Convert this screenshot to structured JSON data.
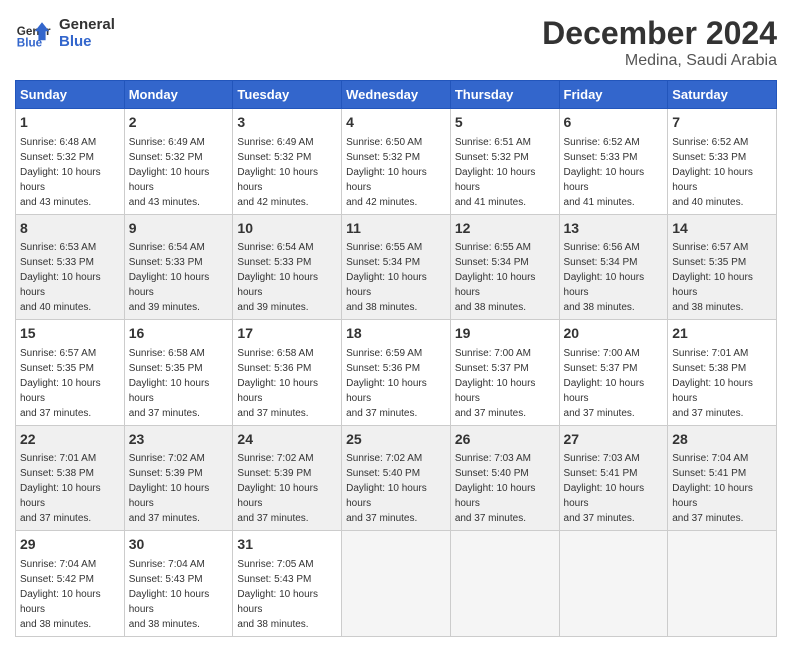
{
  "header": {
    "logo_text_line1": "General",
    "logo_text_line2": "Blue",
    "month_title": "December 2024",
    "location": "Medina, Saudi Arabia"
  },
  "weekdays": [
    "Sunday",
    "Monday",
    "Tuesday",
    "Wednesday",
    "Thursday",
    "Friday",
    "Saturday"
  ],
  "rows": [
    [
      {
        "day": "1",
        "sunrise": "6:48 AM",
        "sunset": "5:32 PM",
        "daylight": "10 hours and 43 minutes."
      },
      {
        "day": "2",
        "sunrise": "6:49 AM",
        "sunset": "5:32 PM",
        "daylight": "10 hours and 43 minutes."
      },
      {
        "day": "3",
        "sunrise": "6:49 AM",
        "sunset": "5:32 PM",
        "daylight": "10 hours and 42 minutes."
      },
      {
        "day": "4",
        "sunrise": "6:50 AM",
        "sunset": "5:32 PM",
        "daylight": "10 hours and 42 minutes."
      },
      {
        "day": "5",
        "sunrise": "6:51 AM",
        "sunset": "5:32 PM",
        "daylight": "10 hours and 41 minutes."
      },
      {
        "day": "6",
        "sunrise": "6:52 AM",
        "sunset": "5:33 PM",
        "daylight": "10 hours and 41 minutes."
      },
      {
        "day": "7",
        "sunrise": "6:52 AM",
        "sunset": "5:33 PM",
        "daylight": "10 hours and 40 minutes."
      }
    ],
    [
      {
        "day": "8",
        "sunrise": "6:53 AM",
        "sunset": "5:33 PM",
        "daylight": "10 hours and 40 minutes."
      },
      {
        "day": "9",
        "sunrise": "6:54 AM",
        "sunset": "5:33 PM",
        "daylight": "10 hours and 39 minutes."
      },
      {
        "day": "10",
        "sunrise": "6:54 AM",
        "sunset": "5:33 PM",
        "daylight": "10 hours and 39 minutes."
      },
      {
        "day": "11",
        "sunrise": "6:55 AM",
        "sunset": "5:34 PM",
        "daylight": "10 hours and 38 minutes."
      },
      {
        "day": "12",
        "sunrise": "6:55 AM",
        "sunset": "5:34 PM",
        "daylight": "10 hours and 38 minutes."
      },
      {
        "day": "13",
        "sunrise": "6:56 AM",
        "sunset": "5:34 PM",
        "daylight": "10 hours and 38 minutes."
      },
      {
        "day": "14",
        "sunrise": "6:57 AM",
        "sunset": "5:35 PM",
        "daylight": "10 hours and 38 minutes."
      }
    ],
    [
      {
        "day": "15",
        "sunrise": "6:57 AM",
        "sunset": "5:35 PM",
        "daylight": "10 hours and 37 minutes."
      },
      {
        "day": "16",
        "sunrise": "6:58 AM",
        "sunset": "5:35 PM",
        "daylight": "10 hours and 37 minutes."
      },
      {
        "day": "17",
        "sunrise": "6:58 AM",
        "sunset": "5:36 PM",
        "daylight": "10 hours and 37 minutes."
      },
      {
        "day": "18",
        "sunrise": "6:59 AM",
        "sunset": "5:36 PM",
        "daylight": "10 hours and 37 minutes."
      },
      {
        "day": "19",
        "sunrise": "7:00 AM",
        "sunset": "5:37 PM",
        "daylight": "10 hours and 37 minutes."
      },
      {
        "day": "20",
        "sunrise": "7:00 AM",
        "sunset": "5:37 PM",
        "daylight": "10 hours and 37 minutes."
      },
      {
        "day": "21",
        "sunrise": "7:01 AM",
        "sunset": "5:38 PM",
        "daylight": "10 hours and 37 minutes."
      }
    ],
    [
      {
        "day": "22",
        "sunrise": "7:01 AM",
        "sunset": "5:38 PM",
        "daylight": "10 hours and 37 minutes."
      },
      {
        "day": "23",
        "sunrise": "7:02 AM",
        "sunset": "5:39 PM",
        "daylight": "10 hours and 37 minutes."
      },
      {
        "day": "24",
        "sunrise": "7:02 AM",
        "sunset": "5:39 PM",
        "daylight": "10 hours and 37 minutes."
      },
      {
        "day": "25",
        "sunrise": "7:02 AM",
        "sunset": "5:40 PM",
        "daylight": "10 hours and 37 minutes."
      },
      {
        "day": "26",
        "sunrise": "7:03 AM",
        "sunset": "5:40 PM",
        "daylight": "10 hours and 37 minutes."
      },
      {
        "day": "27",
        "sunrise": "7:03 AM",
        "sunset": "5:41 PM",
        "daylight": "10 hours and 37 minutes."
      },
      {
        "day": "28",
        "sunrise": "7:04 AM",
        "sunset": "5:41 PM",
        "daylight": "10 hours and 37 minutes."
      }
    ],
    [
      {
        "day": "29",
        "sunrise": "7:04 AM",
        "sunset": "5:42 PM",
        "daylight": "10 hours and 38 minutes."
      },
      {
        "day": "30",
        "sunrise": "7:04 AM",
        "sunset": "5:43 PM",
        "daylight": "10 hours and 38 minutes."
      },
      {
        "day": "31",
        "sunrise": "7:05 AM",
        "sunset": "5:43 PM",
        "daylight": "10 hours and 38 minutes."
      },
      null,
      null,
      null,
      null
    ]
  ],
  "labels": {
    "sunrise": "Sunrise:",
    "sunset": "Sunset:",
    "daylight": "Daylight:"
  }
}
